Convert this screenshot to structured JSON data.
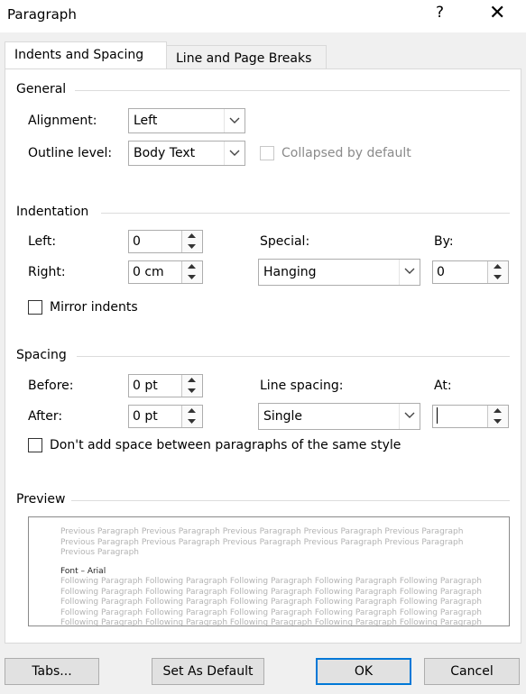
{
  "window": {
    "title": "Paragraph",
    "help_label": "?",
    "close_label": "✕"
  },
  "tabs": [
    {
      "label": "Indents and Spacing",
      "active": true
    },
    {
      "label": "Line and Page Breaks",
      "active": false
    }
  ],
  "general": {
    "heading": "General",
    "alignment_label": "Alignment:",
    "alignment_value": "Left",
    "outline_label": "Outline level:",
    "outline_value": "Body Text",
    "collapsed_label": "Collapsed by default",
    "collapsed_checked": false,
    "collapsed_enabled": false
  },
  "indentation": {
    "heading": "Indentation",
    "left_label": "Left:",
    "left_value": "0",
    "right_label": "Right:",
    "right_value": "0 cm",
    "special_label": "Special:",
    "special_value": "Hanging",
    "by_label": "By:",
    "by_value": "0",
    "mirror_label": "Mirror indents",
    "mirror_checked": false
  },
  "spacing": {
    "heading": "Spacing",
    "before_label": "Before:",
    "before_value": "0 pt",
    "after_label": "After:",
    "after_value": "0 pt",
    "line_spacing_label": "Line spacing:",
    "line_spacing_value": "Single",
    "at_label": "At:",
    "at_value": "",
    "dont_add_label": "Don't add space between paragraphs of the same style",
    "dont_add_checked": false
  },
  "preview": {
    "heading": "Preview",
    "previous_text": "Previous Paragraph Previous Paragraph Previous Paragraph Previous Paragraph Previous Paragraph Previous Paragraph Previous Paragraph Previous Paragraph Previous Paragraph Previous Paragraph Previous Paragraph",
    "font_text": "Font – Arial",
    "following_text": "Following Paragraph Following Paragraph Following Paragraph Following Paragraph Following Paragraph Following Paragraph Following Paragraph Following Paragraph Following Paragraph Following Paragraph Following Paragraph Following Paragraph Following Paragraph Following Paragraph Following Paragraph Following Paragraph Following Paragraph Following Paragraph Following Paragraph Following Paragraph Following Paragraph Following Paragraph Following Paragraph Following Paragraph Following Paragraph"
  },
  "buttons": {
    "tabs": "Tabs...",
    "set_default": "Set As Default",
    "ok": "OK",
    "cancel": "Cancel"
  },
  "colors": {
    "ok_border": "#0078d7",
    "preview_text": "#b3b3b3",
    "disabled_text": "#8a8a8a"
  }
}
